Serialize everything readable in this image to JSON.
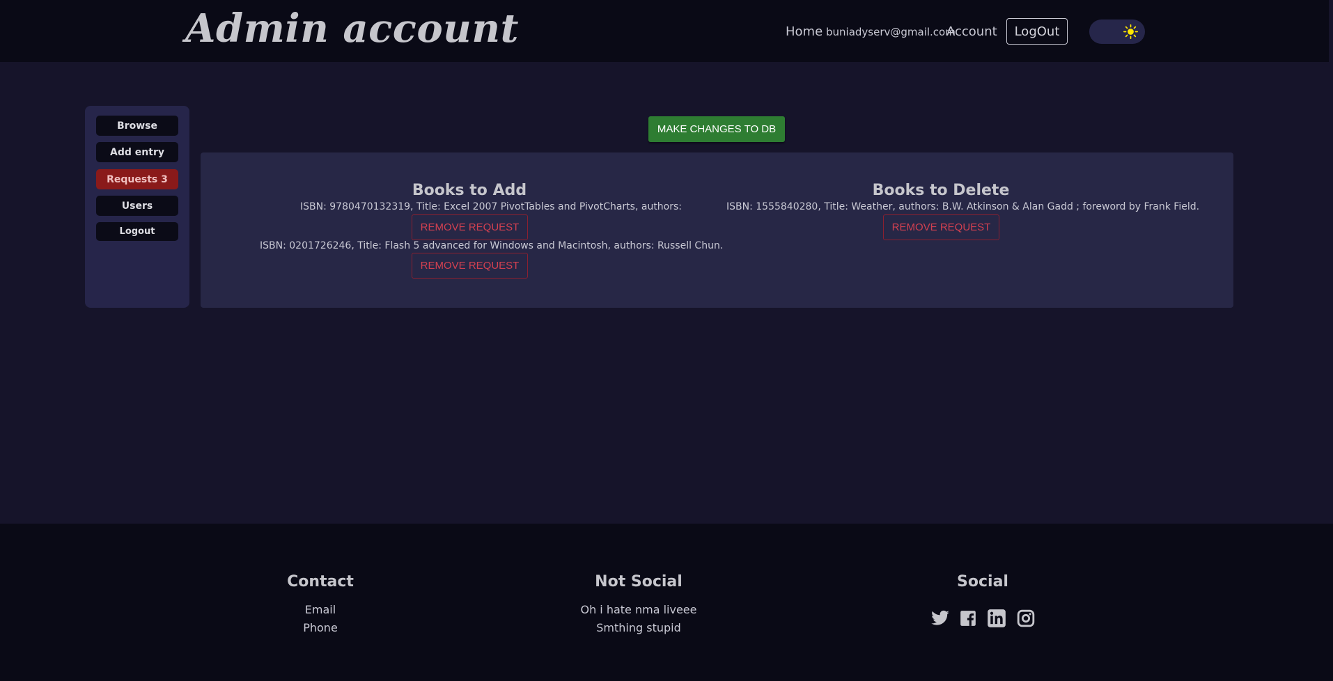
{
  "header": {
    "brand": "Admin account",
    "nav": {
      "home": "Home",
      "email": "buniadyserv@gmail.com",
      "account": "Account",
      "logout": "LogOut"
    },
    "theme_toggle_icon": "sun-icon"
  },
  "sidebar": {
    "items": [
      {
        "label": "Browse"
      },
      {
        "label": "Add entry"
      },
      {
        "label": "Requests 3"
      },
      {
        "label": "Users"
      },
      {
        "label": "Logout"
      }
    ]
  },
  "main": {
    "make_changes_label": "MAKE CHANGES TO DB",
    "add_section": {
      "title": "Books to Add",
      "entries": [
        {
          "text": "ISBN: 9780470132319, Title: Excel 2007 PivotTables and PivotCharts, authors:",
          "button": "REMOVE REQUEST"
        },
        {
          "text": "ISBN: 0201726246, Title: Flash 5 advanced for Windows and Macintosh, authors: Russell Chun.",
          "button": "REMOVE REQUEST"
        }
      ]
    },
    "delete_section": {
      "title": "Books to Delete",
      "entries": [
        {
          "text": "ISBN: 1555840280, Title: Weather, authors: B.W. Atkinson & Alan Gadd ; foreword by Frank Field.",
          "button": "REMOVE REQUEST"
        }
      ]
    }
  },
  "footer": {
    "contact": {
      "title": "Contact",
      "links": [
        "Email",
        "Phone"
      ]
    },
    "not_social": {
      "title": "Not Social",
      "links": [
        "Oh i hate nma liveee",
        "Smthing stupid"
      ]
    },
    "social": {
      "title": "Social",
      "icons": [
        "twitter-icon",
        "facebook-icon",
        "linkedin-icon",
        "instagram-icon"
      ]
    }
  },
  "colors": {
    "background": "#16142a",
    "header": "#0a0a16",
    "panel": "#272746",
    "accent_green": "#2e7d32",
    "danger": "#8a1a1a"
  }
}
